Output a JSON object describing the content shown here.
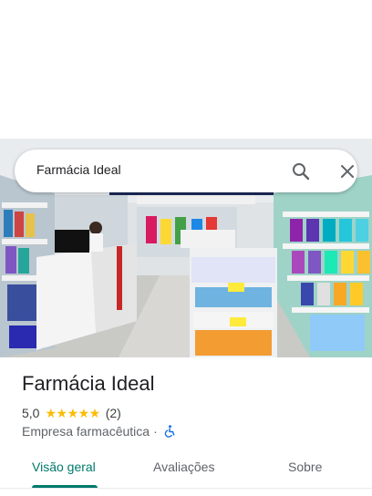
{
  "search": {
    "query": "Farmácia Ideal",
    "search_icon": "search-icon",
    "close_icon": "close-icon"
  },
  "place": {
    "name": "Farmácia Ideal",
    "rating": "5,0",
    "stars": "★★★★★",
    "review_count": "(2)",
    "category": "Empresa farmacêutica",
    "separator": "·",
    "accessibility_icon": "wheelchair-icon"
  },
  "tabs": [
    {
      "label": "Visão geral",
      "active": true
    },
    {
      "label": "Avaliações",
      "active": false
    },
    {
      "label": "Sobre",
      "active": false
    }
  ],
  "colors": {
    "accent": "#00796b",
    "star": "#fbbc04",
    "wheelchair": "#1a73e8"
  }
}
